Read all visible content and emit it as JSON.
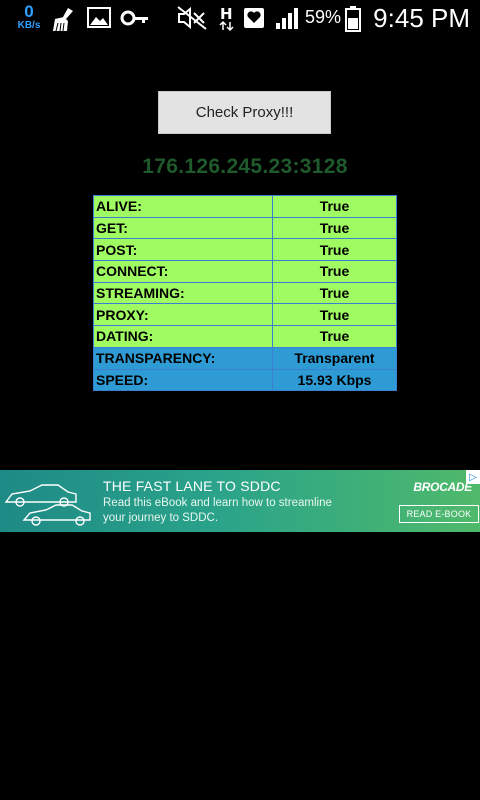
{
  "status_bar": {
    "net_speed_value": "0",
    "net_speed_unit": "KB/s",
    "battery_percent": "59%",
    "time": "9:45 PM",
    "icons": [
      "clean-icon",
      "image-icon",
      "key-icon",
      "mute-icon",
      "hspa-icon",
      "heart-icon",
      "signal-icon",
      "battery-icon"
    ]
  },
  "main": {
    "check_button_label": "Check Proxy!!!",
    "proxy_address": "176.126.245.23:3128"
  },
  "results": [
    {
      "key": "ALIVE:",
      "value": "True",
      "style": "green"
    },
    {
      "key": "GET:",
      "value": "True",
      "style": "green"
    },
    {
      "key": "POST:",
      "value": "True",
      "style": "green"
    },
    {
      "key": "CONNECT:",
      "value": "True",
      "style": "green"
    },
    {
      "key": "STREAMING:",
      "value": "True",
      "style": "green"
    },
    {
      "key": "PROXY:",
      "value": "True",
      "style": "green"
    },
    {
      "key": "DATING:",
      "value": "True",
      "style": "green"
    },
    {
      "key": "TRANSPARENCY:",
      "value": "Transparent",
      "style": "blue"
    },
    {
      "key": "SPEED:",
      "value": "15.93 Kbps",
      "style": "blue"
    }
  ],
  "ad": {
    "headline": "THE FAST LANE TO SDDC",
    "body": "Read this eBook and learn how to streamline your journey to SDDC.",
    "brand": "BROCADE",
    "cta": "READ E-BOOK"
  },
  "colors": {
    "background": "#000000",
    "ip_text": "#1f5a2c",
    "row_green": "#a0fb62",
    "row_blue": "#2f9bd4",
    "table_border": "#3c7fd1",
    "status_accent": "#2ea0ff"
  }
}
